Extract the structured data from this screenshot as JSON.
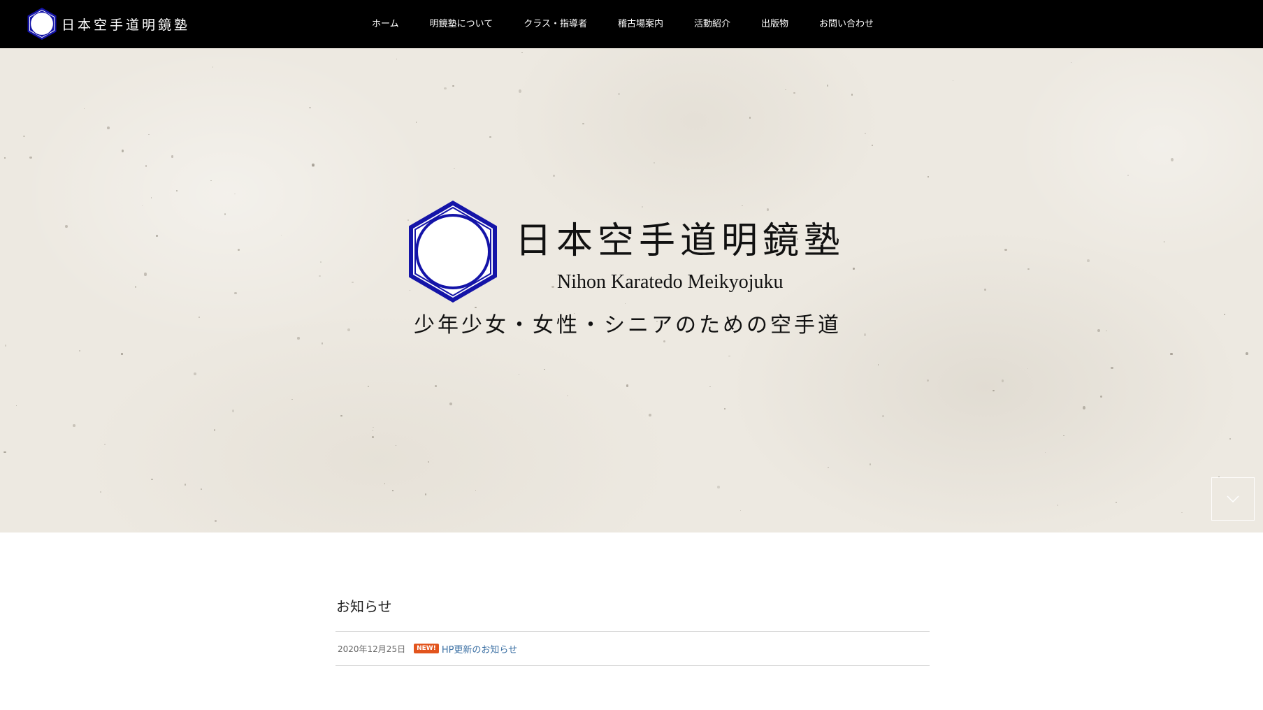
{
  "header": {
    "logo_text": "日本空手道明鏡塾",
    "nav": [
      {
        "label": "ホーム"
      },
      {
        "label": "明鏡塾について"
      },
      {
        "label": "クラス・指導者"
      },
      {
        "label": "稽古場案内"
      },
      {
        "label": "活動紹介"
      },
      {
        "label": "出版物"
      },
      {
        "label": "お問い合わせ"
      }
    ]
  },
  "hero": {
    "title": "日本空手道明鏡塾",
    "subtitle": "Nihon Karatedo Meikyojuku",
    "tagline": "少年少女・女性・シニアのための空手道",
    "emblem_color": "#1414a8"
  },
  "news": {
    "heading": "お知らせ",
    "items": [
      {
        "date": "2020年12月25日",
        "badge": "NEW!",
        "title": "HP更新のお知らせ"
      }
    ]
  },
  "colors": {
    "header_bg": "#000000",
    "badge": "#e2541d",
    "link": "#3a6fa3"
  }
}
